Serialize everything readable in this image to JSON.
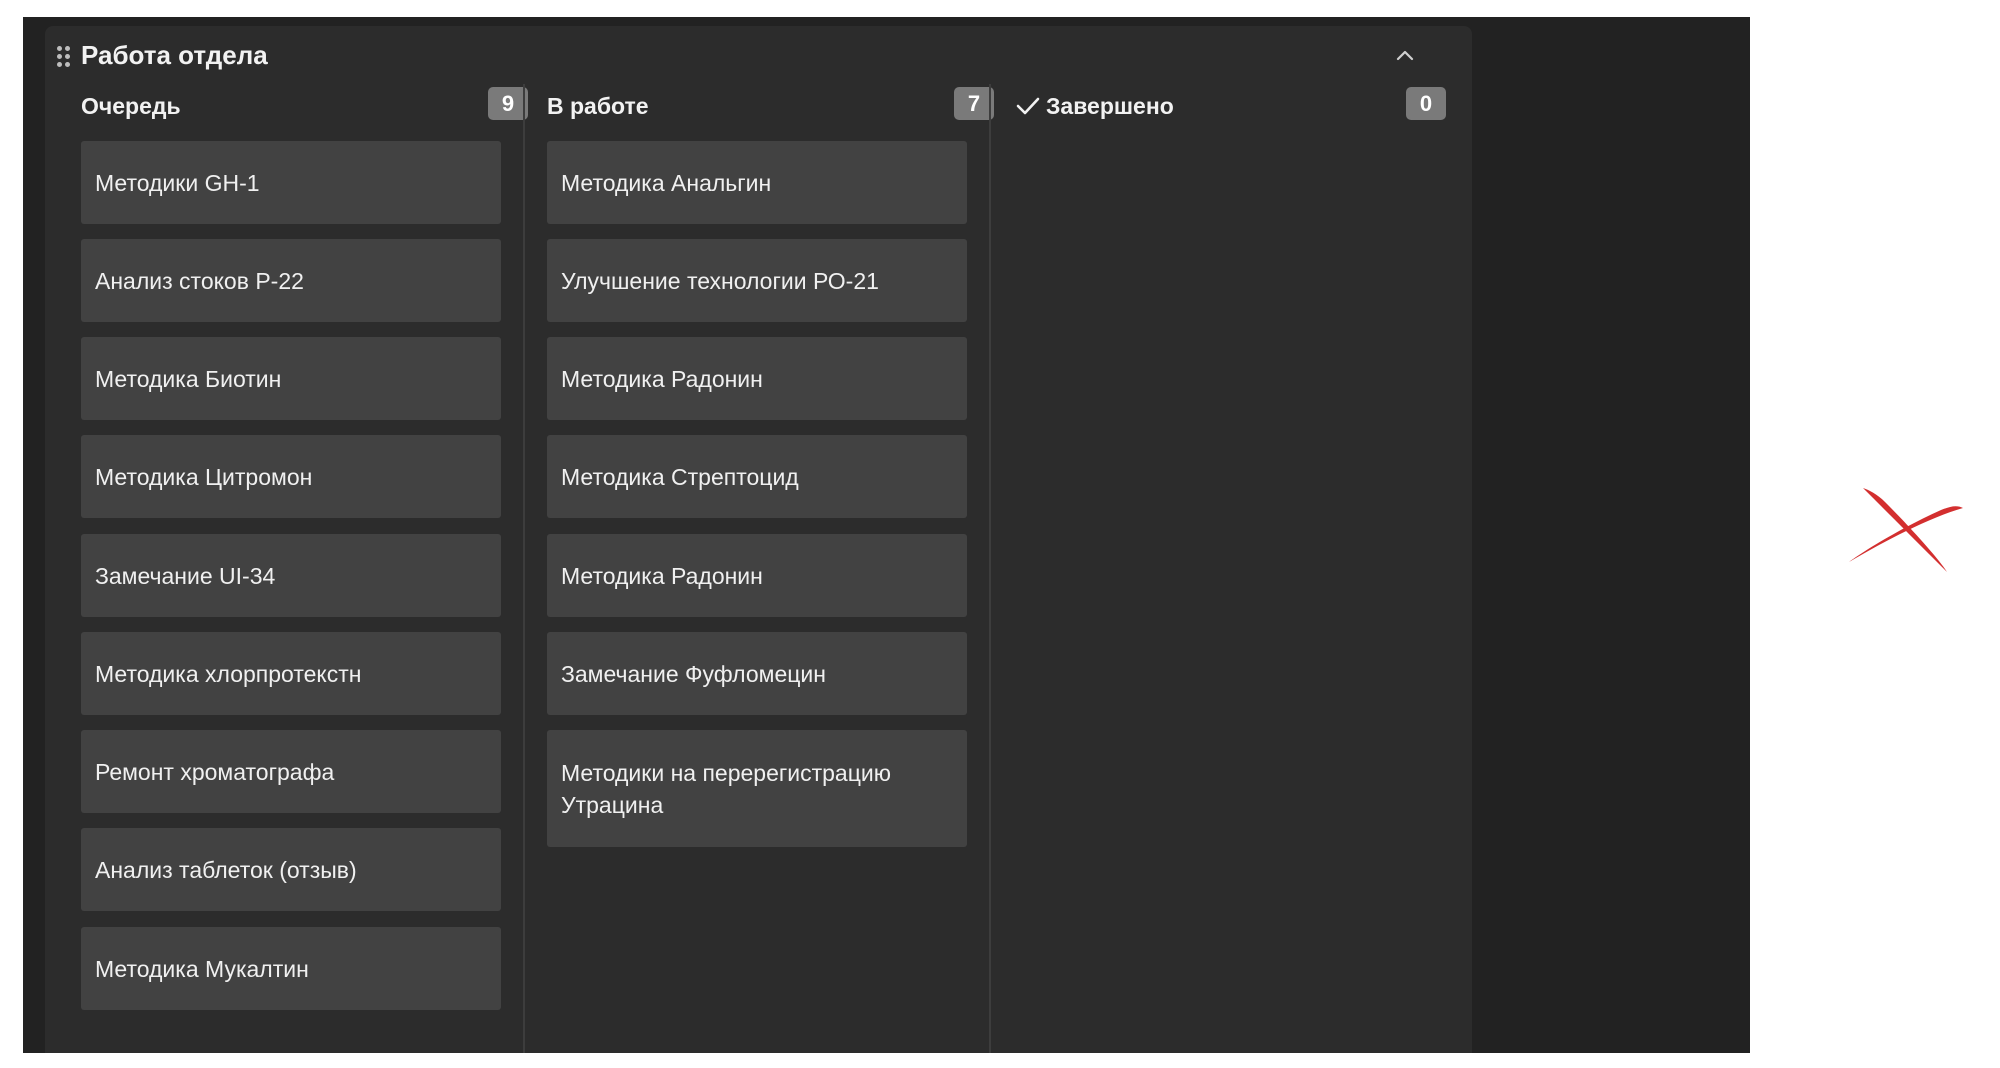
{
  "board": {
    "title": "Работа отдела",
    "icons": {
      "drag": "drag-handle-icon",
      "collapse": "chevron-up-icon"
    }
  },
  "columns": [
    {
      "title": "Очередь",
      "count": "9",
      "cards": [
        "Методики GH-1",
        "Анализ стоков Р-22",
        "Методика Биотин",
        "Методика Цитромон",
        "Замечание UI-34",
        "Методика хлорпротекстн",
        "Ремонт хроматографа",
        "Анализ таблеток (отзыв)",
        "Методика Мукалтин"
      ]
    },
    {
      "title": "В работе",
      "count": "7",
      "cards": [
        "Методика Анальгин",
        "Улучшение технологии РО-21",
        "Методика Радонин",
        "Методика Стрептоцид",
        "Методика Радонин",
        "Замечание Фуфломецин",
        "Методики на перерегистрацию Утрацина"
      ]
    },
    {
      "title": "Завершено",
      "count": "0",
      "icon": "check-icon",
      "cards": []
    }
  ],
  "colors": {
    "background": "#222222",
    "board": "#2c2c2c",
    "card": "#424242",
    "badge": "#7a7a7a",
    "text": "#f2f2f2",
    "annotation": "#d32f2f"
  }
}
